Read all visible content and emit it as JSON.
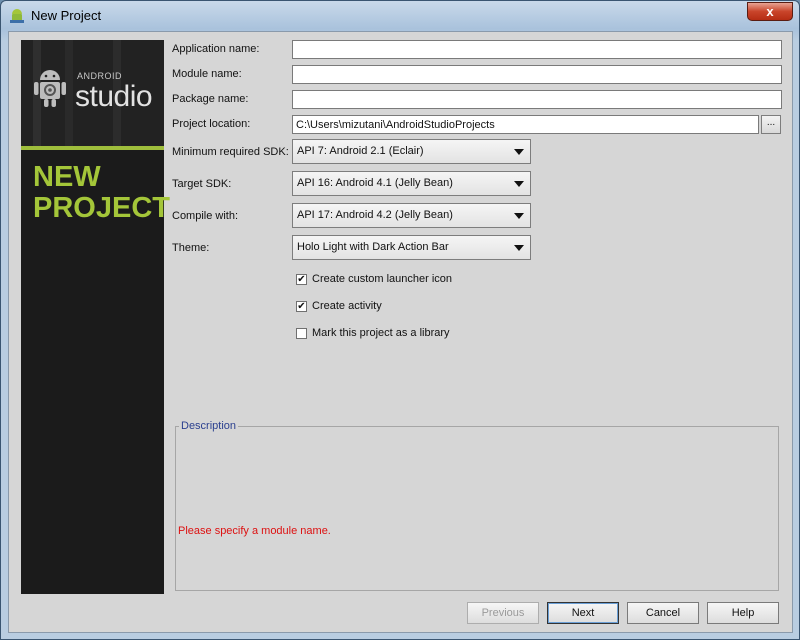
{
  "window": {
    "title": "New Project",
    "close_glyph": "x"
  },
  "banner": {
    "brand_small": "ANDROID",
    "brand_big": "studio",
    "title_line1": "NEW",
    "title_line2": "PROJECT",
    "accent_color": "#a4c639"
  },
  "form": {
    "application_name": {
      "label": "Application name:",
      "value": ""
    },
    "module_name": {
      "label": "Module name:",
      "value": ""
    },
    "package_name": {
      "label": "Package name:",
      "value": ""
    },
    "project_location": {
      "label": "Project location:",
      "value": "C:\\Users\\mizutani\\AndroidStudioProjects",
      "browse_label": "..."
    },
    "min_sdk": {
      "label": "Minimum required SDK:",
      "selected": "API 7: Android 2.1 (Eclair)"
    },
    "target_sdk": {
      "label": "Target SDK:",
      "selected": "API 16: Android 4.1 (Jelly Bean)"
    },
    "compile_with": {
      "label": "Compile with:",
      "selected": "API 17: Android 4.2 (Jelly Bean)"
    },
    "theme": {
      "label": "Theme:",
      "selected": "Holo Light with Dark Action Bar"
    }
  },
  "options": [
    {
      "label": "Create custom launcher icon",
      "checked": true
    },
    {
      "label": "Create activity",
      "checked": true
    },
    {
      "label": "Mark this project as a library",
      "checked": false
    }
  ],
  "description": {
    "legend": "Description",
    "error": "Please specify a module name.",
    "error_color": "#dd1111"
  },
  "buttons": {
    "previous": "Previous",
    "next": "Next",
    "cancel": "Cancel",
    "help": "Help"
  }
}
